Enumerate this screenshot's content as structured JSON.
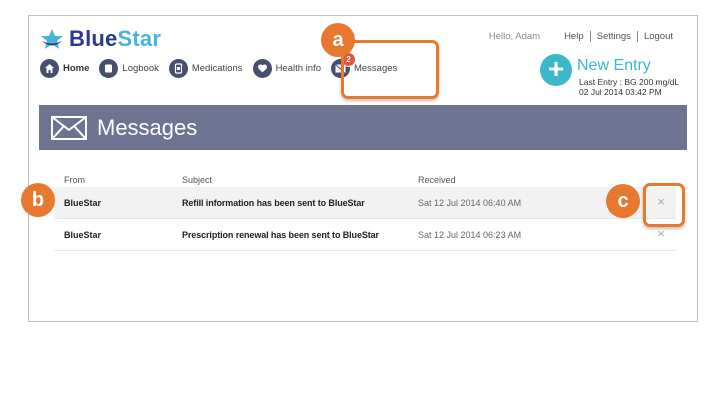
{
  "brand": {
    "name_part1": "Blue",
    "name_part2": "Star"
  },
  "topnav": {
    "greeting": "Hello, Adam",
    "help": "Help",
    "settings": "Settings",
    "logout": "Logout"
  },
  "nav": [
    {
      "label": "Home",
      "icon": "home-icon"
    },
    {
      "label": "Logbook",
      "icon": "logbook-icon"
    },
    {
      "label": "Medications",
      "icon": "medications-icon"
    },
    {
      "label": "Health info",
      "icon": "heart-icon"
    },
    {
      "label": "Messages",
      "icon": "envelope-icon",
      "badge": "2"
    }
  ],
  "new_entry": {
    "title": "New Entry",
    "last_entry": "Last Entry : BG 200 mg/dL",
    "last_entry_time": "02 Jul 2014 03:42 PM"
  },
  "banner": {
    "title": "Messages"
  },
  "table": {
    "headers": {
      "from": "From",
      "subject": "Subject",
      "received": "Received"
    },
    "rows": [
      {
        "from": "BlueStar",
        "subject": "Refill information has been sent to BlueStar",
        "received": "Sat 12 Jul 2014 06:40 AM"
      },
      {
        "from": "BlueStar",
        "subject": "Prescription renewal has been sent to BlueStar",
        "received": "Sat 12 Jul 2014 06:23 AM"
      }
    ],
    "delete_glyph": "×"
  },
  "callouts": {
    "a": "a",
    "b": "b",
    "c": "c"
  },
  "colors": {
    "accent_orange": "#e8782e",
    "banner": "#6d7390",
    "teal": "#3bb8c9",
    "navy": "#2b3a8a"
  }
}
